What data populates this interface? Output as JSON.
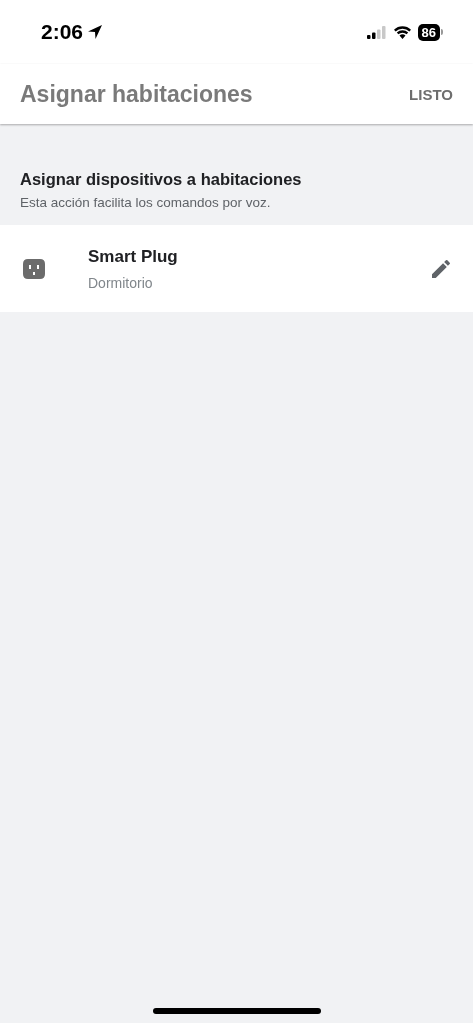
{
  "status_bar": {
    "time": "2:06",
    "battery": "86"
  },
  "header": {
    "title": "Asignar habitaciones",
    "action": "LISTO"
  },
  "section": {
    "title": "Asignar dispositivos a habitaciones",
    "subtitle": "Esta acción facilita los comandos por voz."
  },
  "devices": [
    {
      "name": "Smart Plug",
      "room": "Dormitorio"
    }
  ]
}
